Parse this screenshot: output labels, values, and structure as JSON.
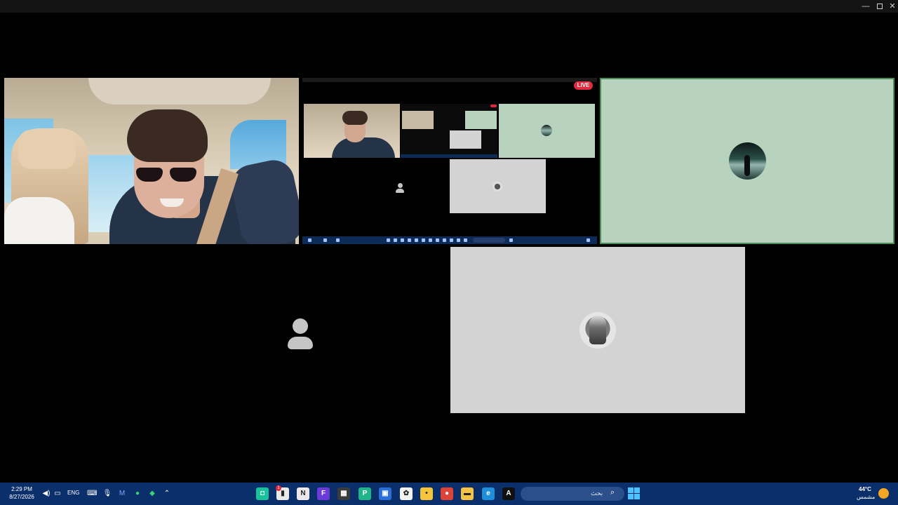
{
  "window": {
    "minimize_glyph": "—",
    "close_glyph": "✕"
  },
  "shared_screen": {
    "live_label": "LIVE"
  },
  "taskbar": {
    "time": "2:29 PM",
    "date": "8/27/2026",
    "language": "ENG",
    "search_placeholder": "بحث",
    "search_icon": "search-icon",
    "notification_count": "1",
    "weather": {
      "temperature": "44°C",
      "condition": "مشمس"
    },
    "apps": [
      {
        "name": "discord-app",
        "glyph": "◘",
        "color": "#19c39a"
      },
      {
        "name": "files-app",
        "glyph": "▮",
        "color": "#e9e9e9"
      },
      {
        "name": "notion-app",
        "glyph": "N",
        "color": "#e9e9e9"
      },
      {
        "name": "flashcards-app",
        "glyph": "F",
        "color": "#6a3bd8"
      },
      {
        "name": "calculator-app",
        "glyph": "▦",
        "color": "#3b3b3b"
      },
      {
        "name": "pass-app",
        "glyph": "P",
        "color": "#1fb489"
      },
      {
        "name": "store-app",
        "glyph": "▣",
        "color": "#2a6fd8"
      },
      {
        "name": "game-app",
        "glyph": "✿",
        "color": "#f2f2f2"
      },
      {
        "name": "chat-app",
        "glyph": "•",
        "color": "#f4c53b"
      },
      {
        "name": "chrome-app",
        "glyph": "●",
        "color": "#db4437"
      },
      {
        "name": "explorer-app",
        "glyph": "▬",
        "color": "#f5c243"
      },
      {
        "name": "edge-app",
        "glyph": "e",
        "color": "#1f8fdb"
      },
      {
        "name": "writing-app",
        "glyph": "A",
        "color": "#101010"
      }
    ]
  },
  "colors": {
    "taskbar": "#0b2f6b",
    "active_speaker_border": "#4a8e58",
    "live_red": "#e2293f"
  }
}
